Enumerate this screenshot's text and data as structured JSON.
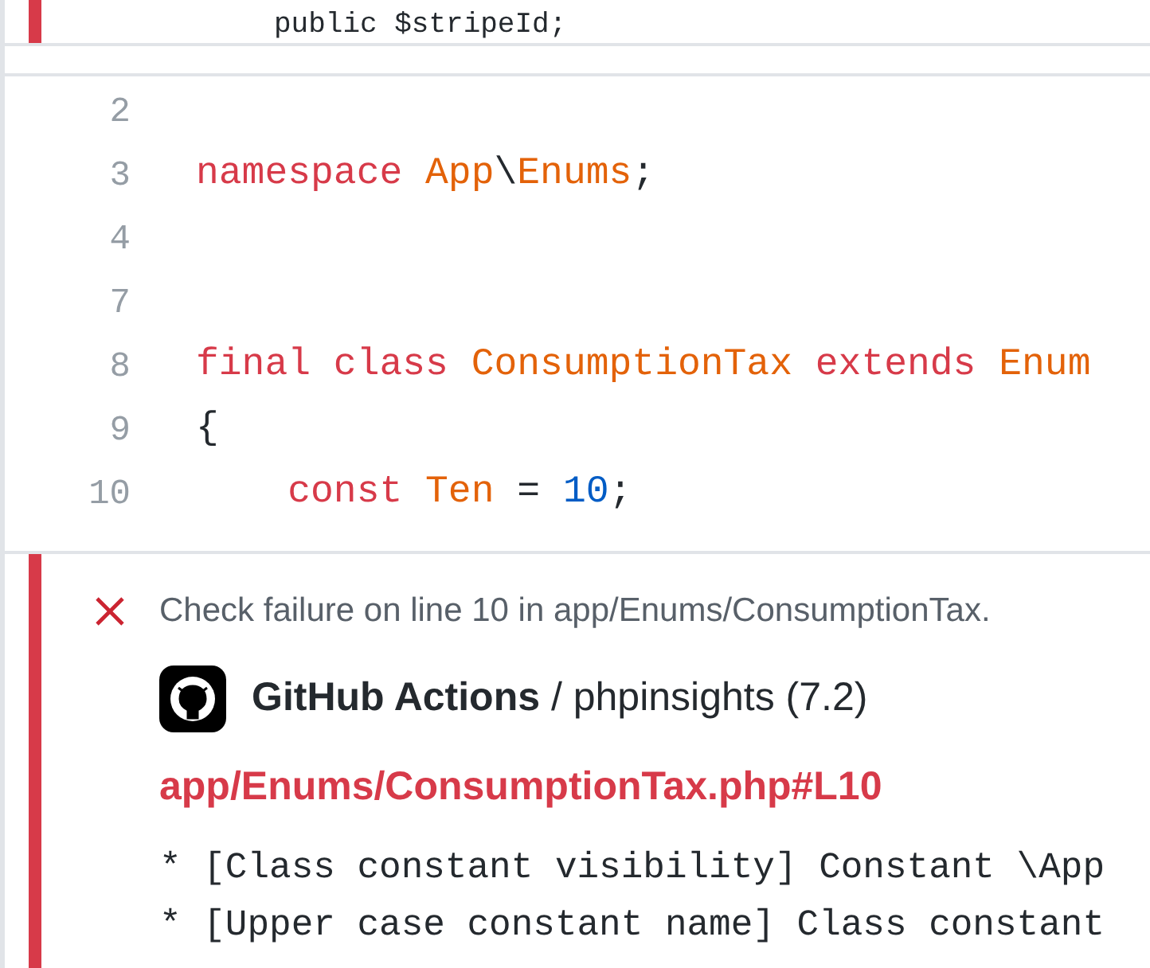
{
  "previous_annotation": {
    "code_line": "public $stripeId;"
  },
  "code_lines": [
    {
      "number": "2"
    },
    {
      "number": "3",
      "tokens": [
        {
          "kind": "keyword",
          "text": "namespace "
        },
        {
          "kind": "name",
          "text": "App"
        },
        {
          "kind": "plain",
          "text": "\\"
        },
        {
          "kind": "name",
          "text": "Enums"
        },
        {
          "kind": "plain",
          "text": ";"
        }
      ]
    },
    {
      "number": "4"
    },
    {
      "number": "7"
    },
    {
      "number": "8",
      "tokens": [
        {
          "kind": "keyword",
          "text": "final "
        },
        {
          "kind": "keyword",
          "text": "class "
        },
        {
          "kind": "name",
          "text": "ConsumptionTax "
        },
        {
          "kind": "keyword",
          "text": "extends "
        },
        {
          "kind": "name",
          "text": "Enum"
        }
      ]
    },
    {
      "number": "9",
      "tokens": [
        {
          "kind": "plain",
          "text": "{"
        }
      ]
    },
    {
      "number": "10",
      "tokens": [
        {
          "kind": "keyword",
          "text": "    const "
        },
        {
          "kind": "name",
          "text": "Ten "
        },
        {
          "kind": "plain",
          "text": "= "
        },
        {
          "kind": "number",
          "text": "10"
        },
        {
          "kind": "plain",
          "text": ";"
        }
      ]
    }
  ],
  "annotation": {
    "title": "Check failure on line 10 in app/Enums/ConsumptionTax.",
    "app": "GitHub Actions",
    "separator": "/",
    "check": "phpinsights (7.2)",
    "path": "app/Enums/ConsumptionTax.php#L10",
    "messages": [
      "* [Class constant visibility] Constant \\App",
      "* [Upper case constant name] Class constant"
    ]
  }
}
